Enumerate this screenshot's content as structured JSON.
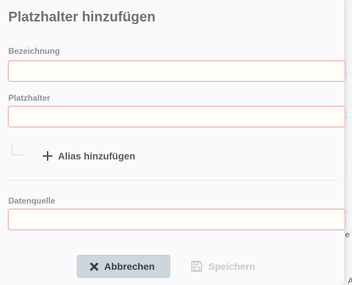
{
  "dialog": {
    "title": "Platzhalter hinzufügen"
  },
  "fields": {
    "bezeichnung": {
      "label": "Bezeichnung",
      "value": ""
    },
    "platzhalter": {
      "label": "Platzhalter",
      "value": ""
    },
    "datenquelle": {
      "label": "Datenquelle",
      "value": ""
    }
  },
  "alias": {
    "add_label": "Alias hinzufügen"
  },
  "footer": {
    "cancel_label": "Abbrechen",
    "save_label": "Speichern"
  },
  "background": {
    "partial_text_1": "e",
    "partial_text_2": "A"
  },
  "colors": {
    "input_border": "#f3c5c8",
    "cancel_bg": "#cdd5dd",
    "save_disabled": "#c7c9cd"
  }
}
